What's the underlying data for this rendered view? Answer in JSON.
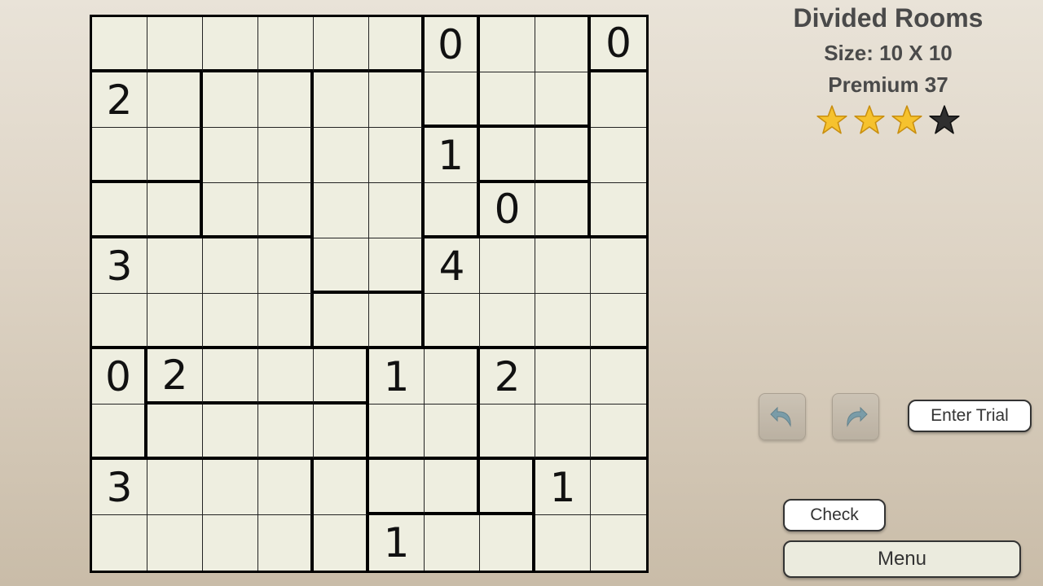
{
  "info": {
    "title": "Divided Rooms",
    "size_label": "Size: 10 X 10",
    "puzzle_label": "Premium 37",
    "rating": 3,
    "max_rating": 4
  },
  "colors": {
    "cell_bg": "#eeeee0",
    "line": "#000000",
    "star_on": "#f6c22e",
    "star_off": "#2f2f2f"
  },
  "board": {
    "rows": 10,
    "cols": 10,
    "rooms": [
      [
        1,
        1,
        1,
        1,
        1,
        1,
        2,
        3,
        3,
        4
      ],
      [
        5,
        5,
        6,
        6,
        7,
        7,
        2,
        3,
        3,
        8
      ],
      [
        5,
        5,
        6,
        6,
        7,
        7,
        9,
        10,
        10,
        8
      ],
      [
        11,
        11,
        6,
        6,
        7,
        7,
        9,
        12,
        12,
        8
      ],
      [
        13,
        13,
        13,
        13,
        7,
        7,
        14,
        14,
        14,
        14
      ],
      [
        13,
        13,
        13,
        13,
        15,
        15,
        14,
        14,
        14,
        14
      ],
      [
        16,
        17,
        17,
        17,
        17,
        18,
        18,
        19,
        19,
        19
      ],
      [
        16,
        20,
        20,
        20,
        20,
        18,
        18,
        19,
        19,
        19
      ],
      [
        21,
        21,
        21,
        21,
        22,
        23,
        23,
        24,
        25,
        25
      ],
      [
        21,
        21,
        21,
        21,
        22,
        26,
        26,
        26,
        25,
        25
      ]
    ],
    "clues": [
      [
        "",
        "",
        "",
        "",
        "",
        "",
        "0",
        "",
        "",
        "0"
      ],
      [
        "2",
        "",
        "",
        "",
        "",
        "",
        "",
        "",
        "",
        ""
      ],
      [
        "",
        "",
        "",
        "",
        "",
        "",
        "1",
        "",
        "",
        ""
      ],
      [
        "",
        "",
        "",
        "",
        "",
        "",
        "",
        "0",
        "",
        ""
      ],
      [
        "3",
        "",
        "",
        "",
        "",
        "",
        "4",
        "",
        "",
        ""
      ],
      [
        "",
        "",
        "",
        "",
        "",
        "",
        "",
        "",
        "",
        ""
      ],
      [
        "0",
        "2",
        "",
        "",
        "",
        "1",
        "",
        "2",
        "",
        ""
      ],
      [
        "",
        "",
        "",
        "",
        "",
        "",
        "",
        "",
        "",
        ""
      ],
      [
        "3",
        "",
        "",
        "",
        "",
        "",
        "",
        "",
        "1",
        ""
      ],
      [
        "",
        "",
        "",
        "",
        "",
        "1",
        "",
        "",
        "",
        ""
      ]
    ]
  },
  "controls": {
    "undo_icon": "undo-arrow-icon",
    "redo_icon": "redo-arrow-icon",
    "enter_trial_label": "Enter Trial",
    "check_label": "Check",
    "menu_label": "Menu"
  }
}
